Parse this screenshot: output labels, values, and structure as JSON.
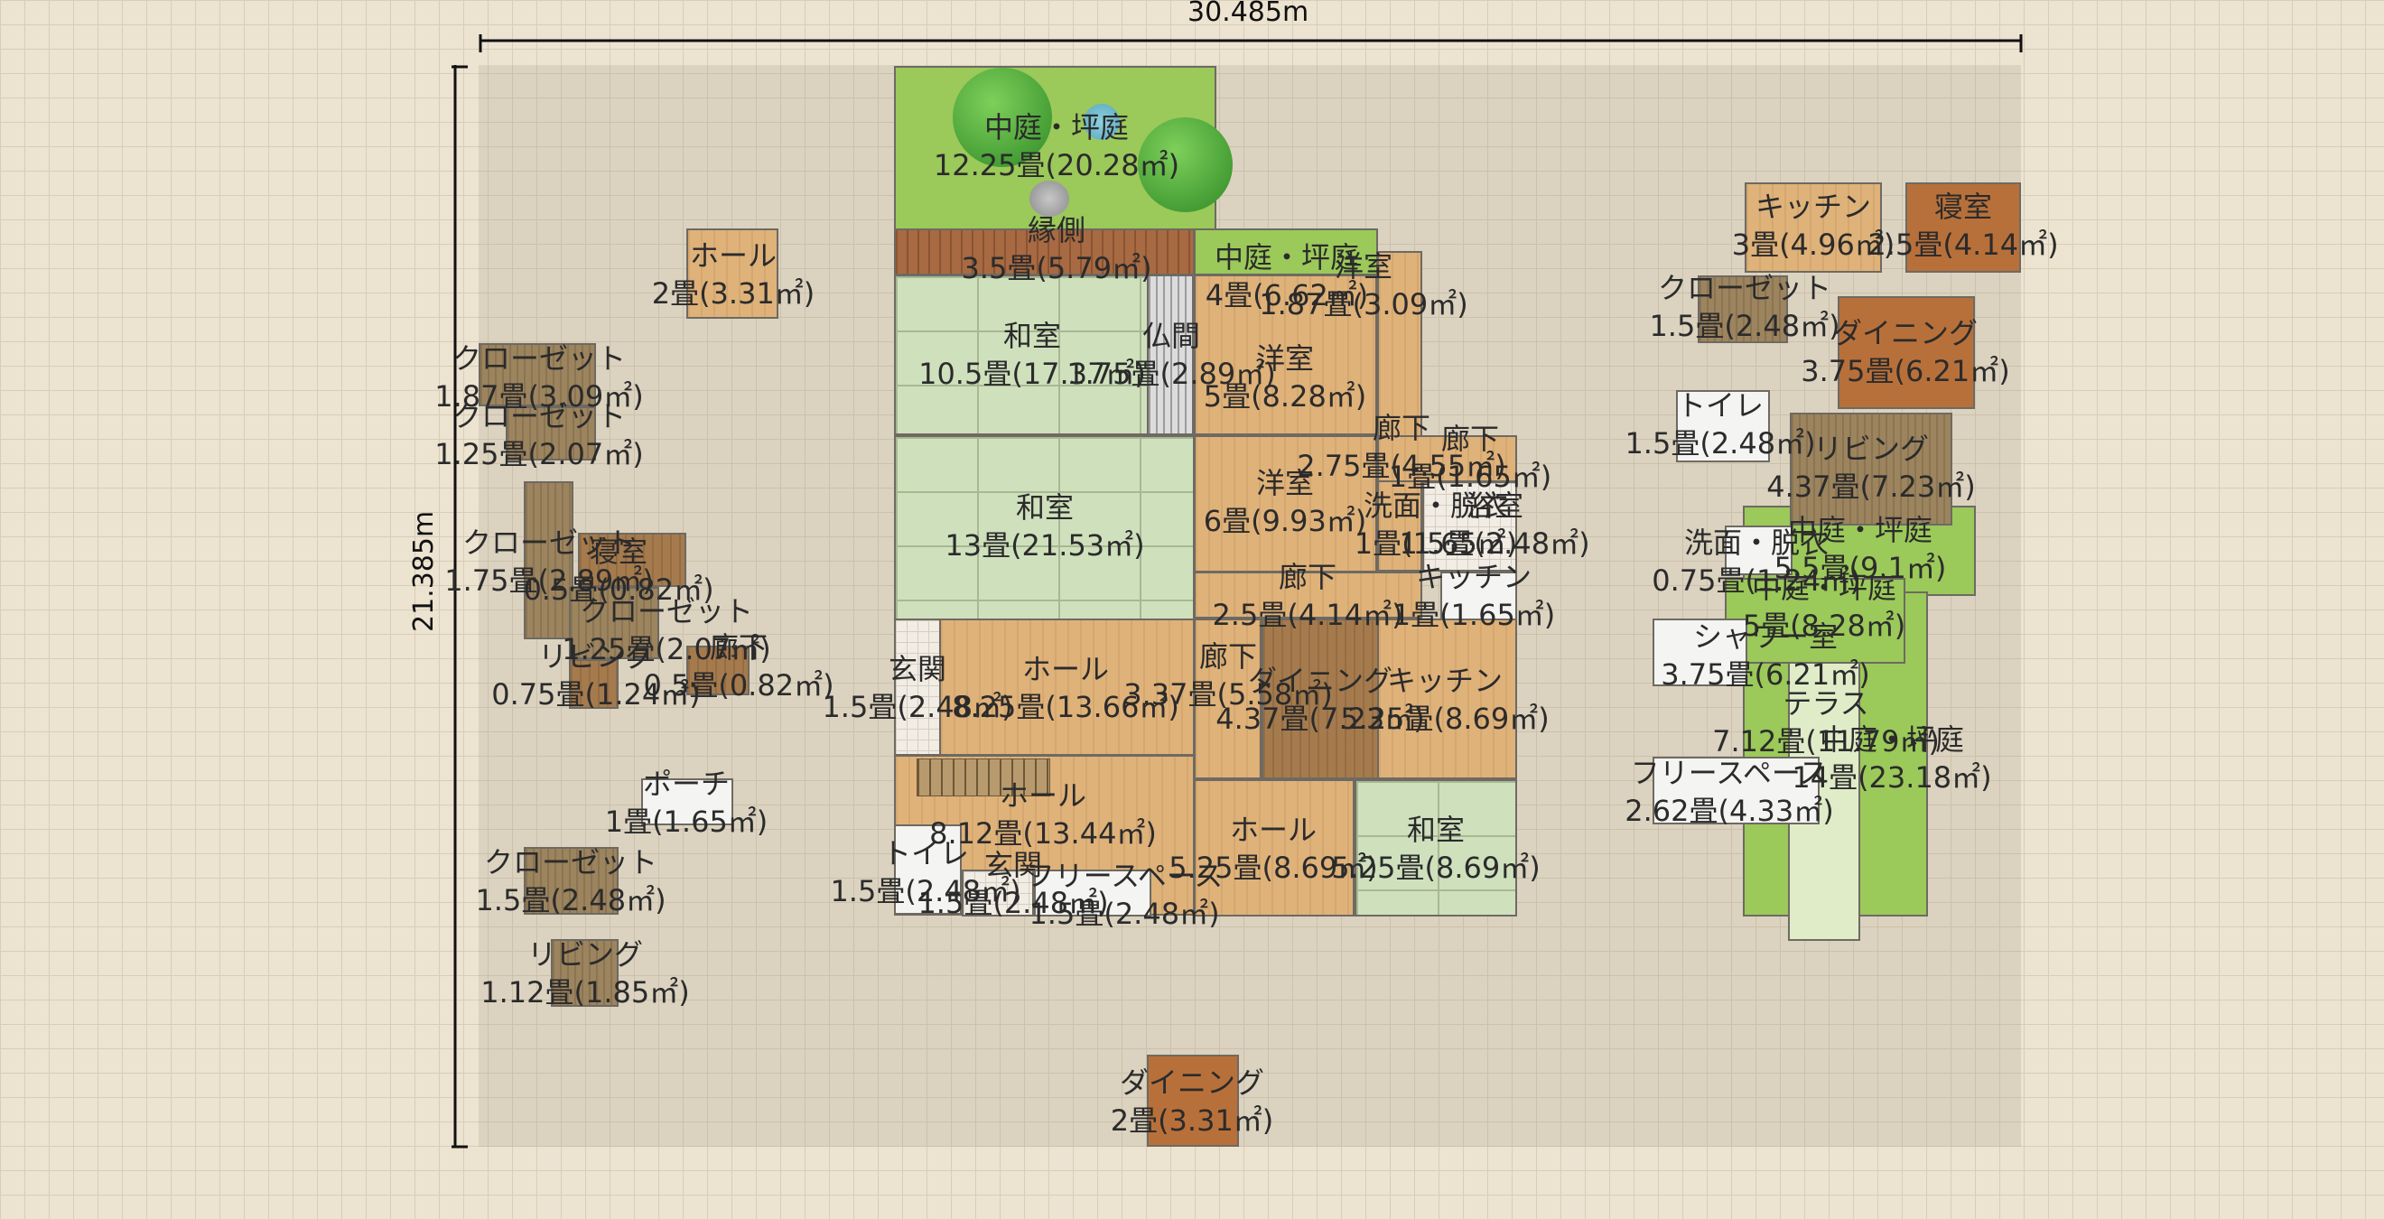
{
  "dimensions": {
    "width": "30.485m",
    "height": "21.385m"
  },
  "rooms": [
    {
      "name": "中庭・坪庭",
      "area": "12.25畳(20.28㎡)"
    },
    {
      "name": "縁側",
      "area": "3.5畳(5.79㎡)"
    },
    {
      "name": "中庭・坪庭",
      "area": "4畳(6.62㎡)"
    },
    {
      "name": "洋室",
      "area": "1.87畳(3.09㎡)"
    },
    {
      "name": "和室",
      "area": "10.5畳(17.37㎡)"
    },
    {
      "name": "仏間",
      "area": "1.75畳(2.89㎡)"
    },
    {
      "name": "洋室",
      "area": "5畳(8.28㎡)"
    },
    {
      "name": "和室",
      "area": "13畳(21.53㎡)"
    },
    {
      "name": "洋室",
      "area": "6畳(9.93㎡)"
    },
    {
      "name": "廊下",
      "area": "2.75畳(4.55㎡)"
    },
    {
      "name": "廊下",
      "area": "1畳(1.65㎡)"
    },
    {
      "name": "洗面・脱衣",
      "area": "1畳(1.65㎡)"
    },
    {
      "name": "浴室",
      "area": "1.5畳(2.48㎡)"
    },
    {
      "name": "廊下",
      "area": "2.5畳(4.14㎡)"
    },
    {
      "name": "キッチン",
      "area": "1畳(1.65㎡)"
    },
    {
      "name": "玄関",
      "area": "1.5畳(2.48㎡)"
    },
    {
      "name": "ホール",
      "area": "8.25畳(13.66㎡)"
    },
    {
      "name": "廊下",
      "area": "3.37畳(5.58㎡)"
    },
    {
      "name": "ダイニング",
      "area": "4.37畳(7.23㎡)"
    },
    {
      "name": "キッチン",
      "area": "5.25畳(8.69㎡)"
    },
    {
      "name": "ホール",
      "area": "8.12畳(13.44㎡)"
    },
    {
      "name": "ホール",
      "area": "5.25畳(8.69㎡)"
    },
    {
      "name": "和室",
      "area": "5.25畳(8.69㎡)"
    },
    {
      "name": "トイレ",
      "area": "1.5畳(2.48㎡)"
    },
    {
      "name": "玄関",
      "area": "1.5畳(2.48㎡)"
    },
    {
      "name": "フリースペース",
      "area": "1.5畳(2.48㎡)"
    },
    {
      "name": "ダイニング",
      "area": "2畳(3.31㎡)"
    },
    {
      "name": "ホール",
      "area": "2畳(3.31㎡)"
    },
    {
      "name": "クローゼット",
      "area": "1.87畳(3.09㎡)"
    },
    {
      "name": "クローゼット",
      "area": "1.25畳(2.07㎡)"
    },
    {
      "name": "クローゼット",
      "area": "1.75畳(2.89㎡)"
    },
    {
      "name": "寝室",
      "area": "0.5畳(0.82㎡)"
    },
    {
      "name": "クローゼット",
      "area": "1.25畳(2.07㎡)"
    },
    {
      "name": "リビング",
      "area": "0.75畳(1.24㎡)"
    },
    {
      "name": "廊下",
      "area": "0.5畳(0.82㎡)"
    },
    {
      "name": "ポーチ",
      "area": "1畳(1.65㎡)"
    },
    {
      "name": "クローゼット",
      "area": "1.5畳(2.48㎡)"
    },
    {
      "name": "リビング",
      "area": "1.12畳(1.85㎡)"
    },
    {
      "name": "キッチン",
      "area": "3畳(4.96㎡)"
    },
    {
      "name": "寝室",
      "area": "2.5畳(4.14㎡)"
    },
    {
      "name": "クローゼット",
      "area": "1.5畳(2.48㎡)"
    },
    {
      "name": "ダイニング",
      "area": "3.75畳(6.21㎡)"
    },
    {
      "name": "トイレ",
      "area": "1.5畳(2.48㎡)"
    },
    {
      "name": "リビング",
      "area": "4.37畳(7.23㎡)"
    },
    {
      "name": "中庭・坪庭",
      "area": "5.5畳(9.1㎡)"
    },
    {
      "name": "洗面・脱衣",
      "area": "0.75畳(1.24㎡)"
    },
    {
      "name": "中庭・坪庭",
      "area": "5畳(8.28㎡)"
    },
    {
      "name": "シャワー室",
      "area": "3.75畳(6.21㎡)"
    },
    {
      "name": "テラス",
      "area": "7.12畳(11.79㎡)"
    },
    {
      "name": "中庭・坪庭",
      "area": "14畳(23.18㎡)"
    },
    {
      "name": "フリースペース",
      "area": "2.62畳(4.33㎡)"
    }
  ],
  "colors": {
    "background": "#ece3d1",
    "tatami": "#cfe0bd",
    "wood": "#dfb27a",
    "garden": "#9bc95a",
    "dark_wood": "#a57b4e"
  }
}
